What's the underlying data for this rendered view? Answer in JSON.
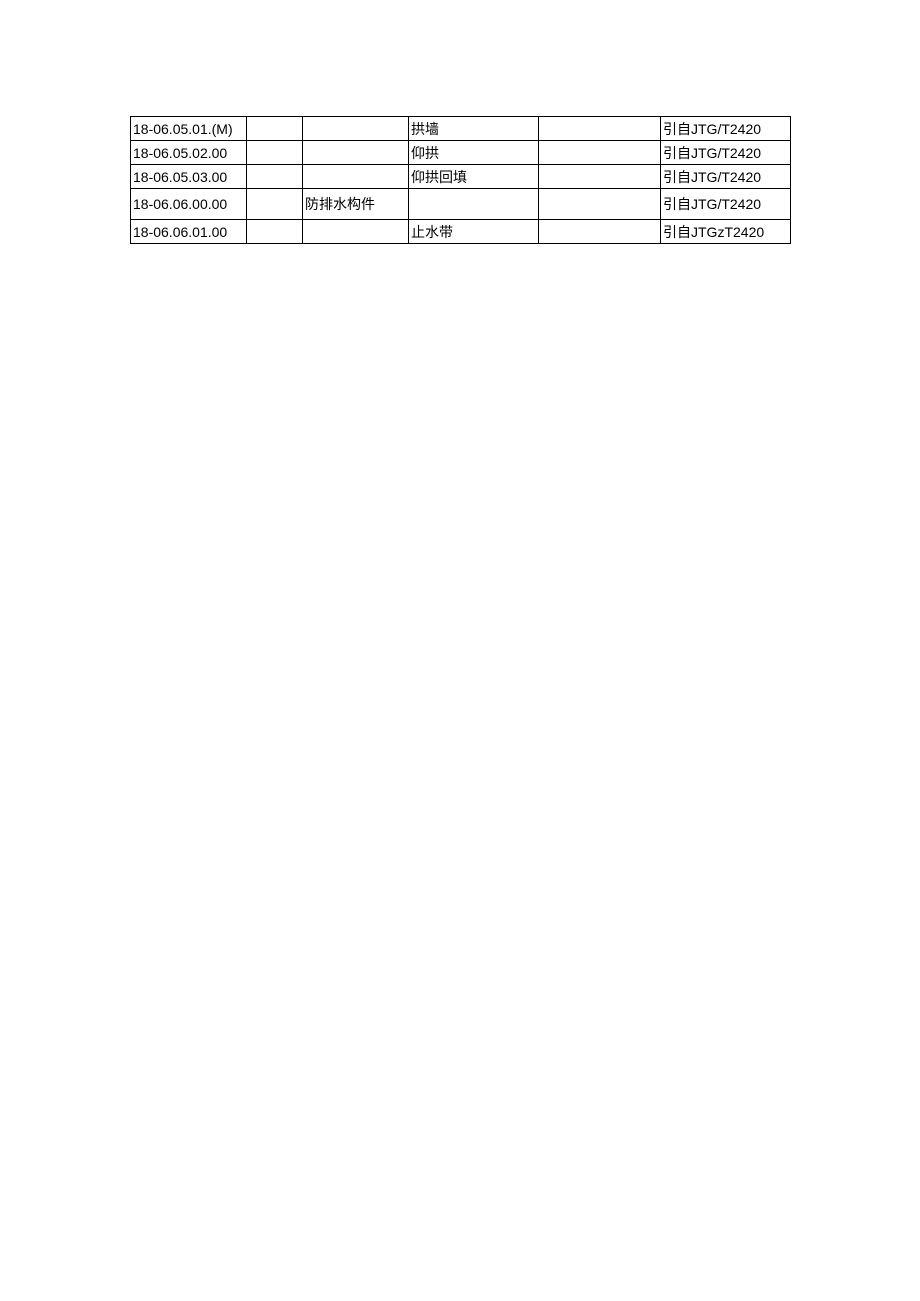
{
  "rows": [
    {
      "code": "18-06.05.01.(M)",
      "col2": "",
      "col3": "",
      "col4": "拱墙",
      "col5": "",
      "ref": "引自JTG/T2420"
    },
    {
      "code": "18-06.05.02.00",
      "col2": "",
      "col3": "",
      "col4": "仰拱",
      "col5": "",
      "ref": "引自JTG/T2420"
    },
    {
      "code": "18-06.05.03.00",
      "col2": "",
      "col3": "",
      "col4": "仰拱回填",
      "col5": "",
      "ref": "引自JTG/T2420"
    },
    {
      "code": "18-06.06.00.00",
      "col2": "",
      "col3": "防排水构件",
      "col4": "",
      "col5": "",
      "ref": "引自JTG/T2420",
      "tall": true
    },
    {
      "code": "18-06.06.01.00",
      "col2": "",
      "col3": "",
      "col4": "止水带",
      "col5": "",
      "ref": "引自JTGzT2420"
    }
  ]
}
